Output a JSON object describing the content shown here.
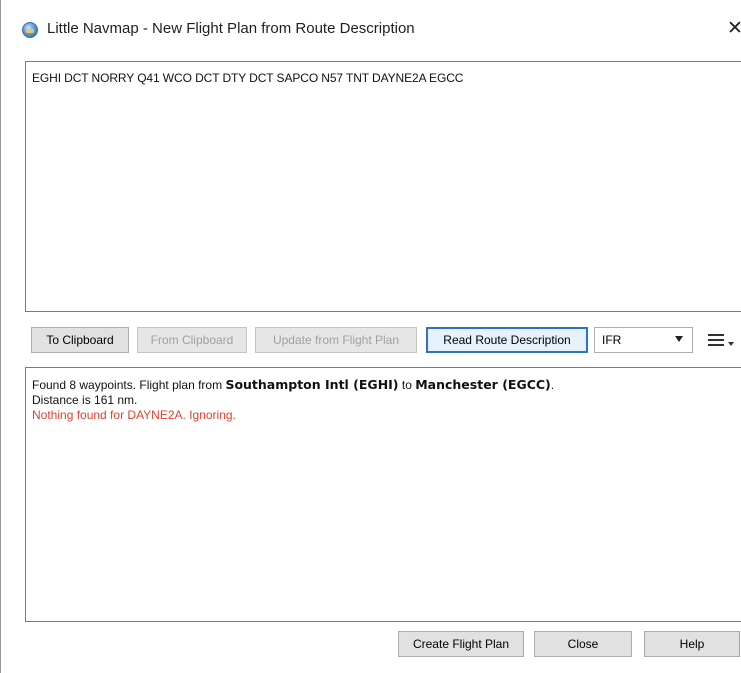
{
  "window": {
    "title": "Little Navmap - New Flight Plan from Route Description",
    "close_symbol": "✕",
    "icon": "little-navmap-app-icon"
  },
  "route": {
    "text": "EGHI DCT NORRY Q41 WCO DCT DTY DCT SAPCO N57 TNT DAYNE2A EGCC"
  },
  "toolbar": {
    "to_clipboard": "To Clipboard",
    "from_clipboard": "From Clipboard",
    "update_from_flight_plan": "Update from Flight Plan",
    "read_route_description": "Read Route Description",
    "flight_rules_selected": "IFR",
    "menu_icon": "hamburger-menu-icon"
  },
  "result": {
    "line1_prefix": "Found 8 waypoints. Flight plan from ",
    "departure": "Southampton Intl (EGHI)",
    "line1_mid": " to ",
    "destination": "Manchester (EGCC)",
    "line1_suffix": ".",
    "line2": "Distance is 161 nm.",
    "error": "Nothing found for DAYNE2A. Ignoring."
  },
  "footer": {
    "create_flight_plan": "Create Flight Plan",
    "close": "Close",
    "help": "Help"
  },
  "colors": {
    "error_text": "#e0412f",
    "focus_border": "#2f72c4"
  }
}
